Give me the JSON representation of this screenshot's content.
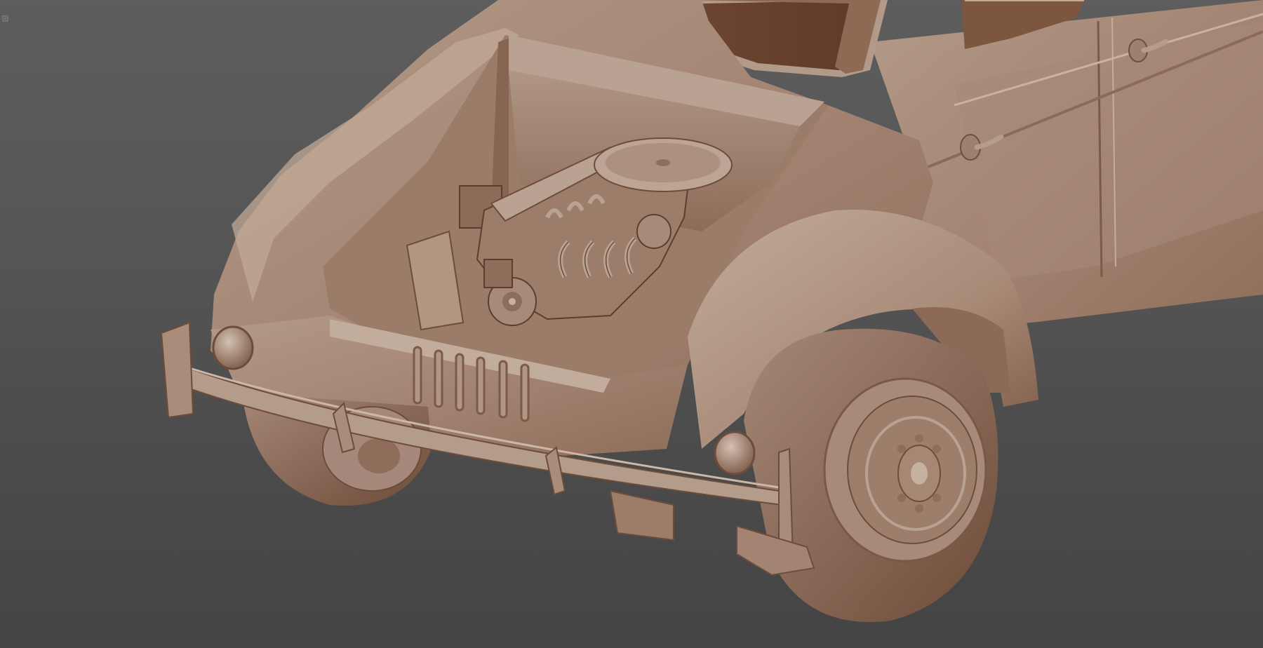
{
  "viewport": {
    "name": "3d-viewport",
    "background_top": "#5d5d5d",
    "background_bottom": "#444444",
    "model_color": "#a68a78",
    "shadow_color": "#6b4533",
    "highlight_color": "#c8b3a3"
  },
  "model": {
    "subject": "vintage-car-clay-render",
    "parts": [
      "body",
      "hood",
      "engine",
      "front-bumper",
      "front-left-wheel",
      "front-right-wheel",
      "front-right-fender",
      "side-doors",
      "windshield",
      "headlights",
      "door-handles",
      "front-grille"
    ]
  },
  "widget": {
    "icon": "viewport-menu-icon"
  }
}
